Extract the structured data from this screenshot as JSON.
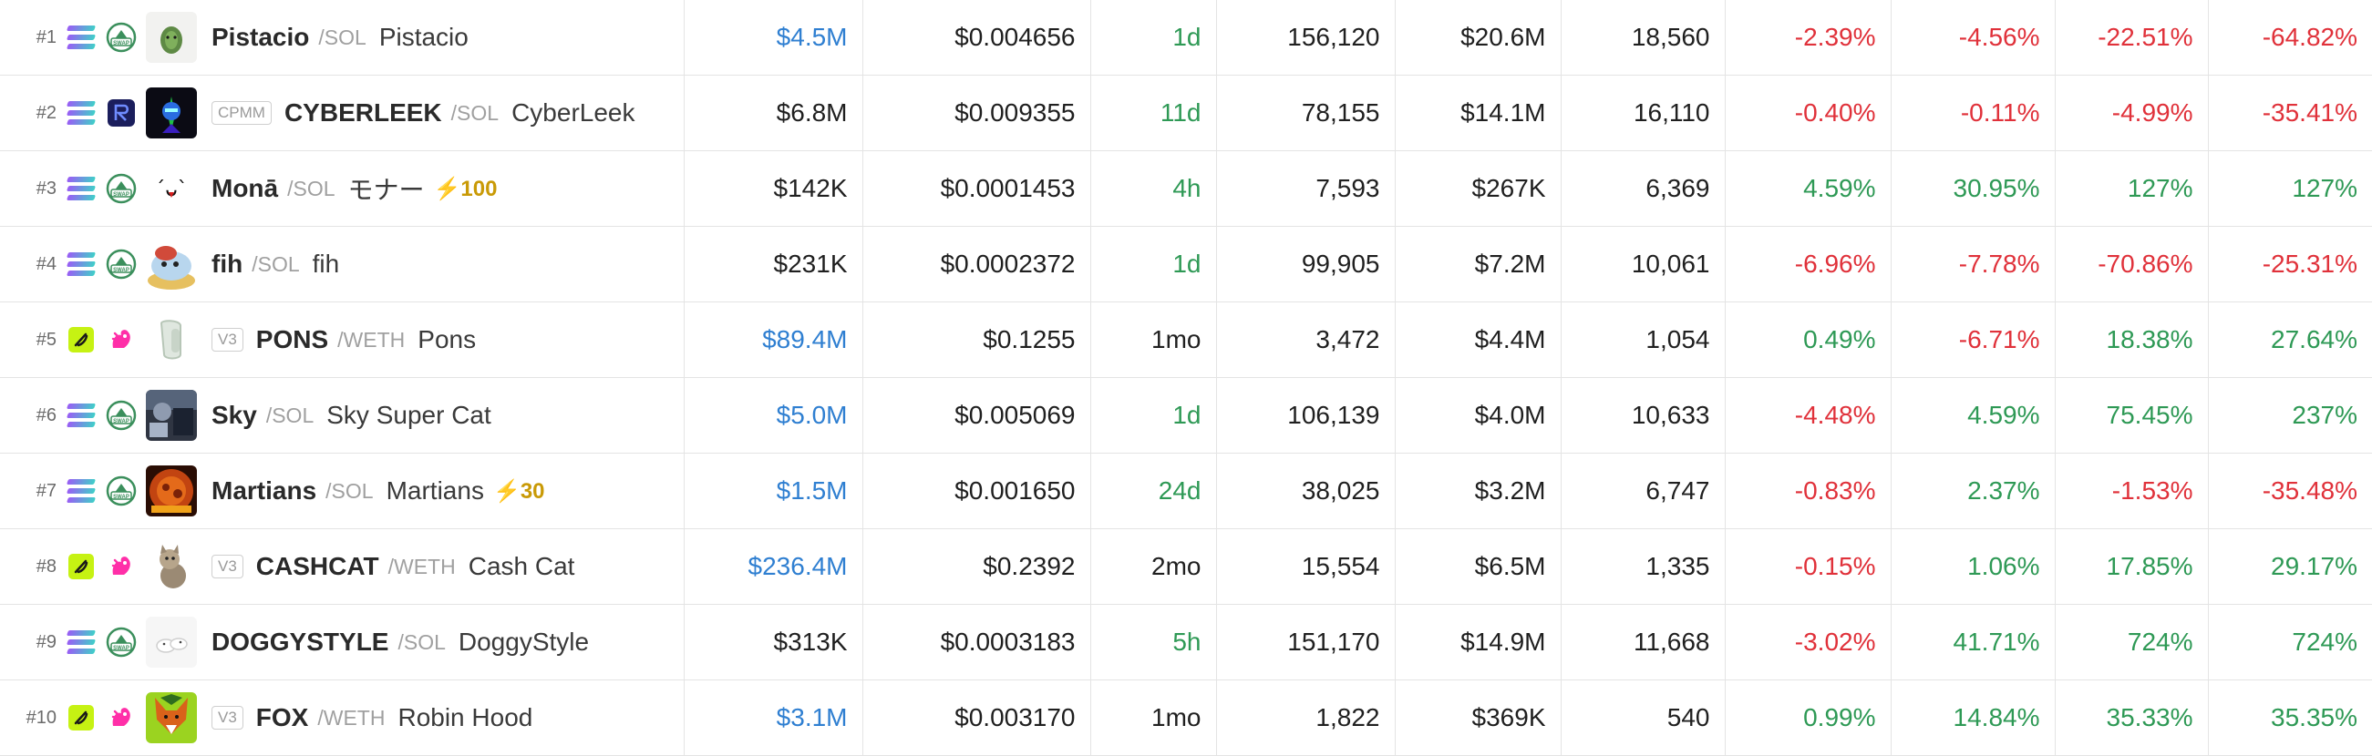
{
  "colors": {
    "positive": "#2e9955",
    "negative": "#e0313a",
    "link_blue": "#2f7fd1",
    "boost": "#c99a06"
  },
  "rows": [
    {
      "rank": "#1",
      "chain_icon": "solana-icon",
      "dex_icon": "raydium-swap-icon",
      "avatar": "pistachio-avatar",
      "badge": "",
      "symbol": "Pistacio",
      "quote": "/SOL",
      "name": "Pistacio",
      "boost": "",
      "liquidity": "$4.5M",
      "price": "$0.004656",
      "age": "1d",
      "txns": "156,120",
      "volume": "$20.6M",
      "makers": "18,560",
      "ch5m": "-2.39%",
      "ch1h": "-4.56%",
      "ch6h": "-22.51%",
      "ch24h": "-64.82%",
      "price_blue": true,
      "age_green": true
    },
    {
      "rank": "#2",
      "chain_icon": "solana-icon",
      "dex_icon": "raydium-cpmm-icon",
      "avatar": "cyberleek-avatar",
      "badge": "CPMM",
      "symbol": "CYBERLEEK",
      "quote": "/SOL",
      "name": "CyberLeek",
      "boost": "",
      "liquidity": "$6.8M",
      "price": "$0.009355",
      "age": "11d",
      "txns": "78,155",
      "volume": "$14.1M",
      "makers": "16,110",
      "ch5m": "-0.40%",
      "ch1h": "-0.11%",
      "ch6h": "-4.99%",
      "ch24h": "-35.41%",
      "age_green": true
    },
    {
      "rank": "#3",
      "chain_icon": "solana-icon",
      "dex_icon": "raydium-swap-icon",
      "avatar": "mona-avatar",
      "badge": "",
      "symbol": "Monā",
      "quote": "/SOL",
      "name": "モナー",
      "boost": "⚡100",
      "liquidity": "$142K",
      "price": "$0.0001453",
      "age": "4h",
      "txns": "7,593",
      "volume": "$267K",
      "makers": "6,369",
      "ch5m": "4.59%",
      "ch1h": "30.95%",
      "ch6h": "127%",
      "ch24h": "127%",
      "age_green": true
    },
    {
      "rank": "#4",
      "chain_icon": "solana-icon",
      "dex_icon": "raydium-swap-icon",
      "avatar": "fih-avatar",
      "badge": "",
      "symbol": "fih",
      "quote": "/SOL",
      "name": "fih",
      "boost": "",
      "liquidity": "$231K",
      "price": "$0.0002372",
      "age": "1d",
      "txns": "99,905",
      "volume": "$7.2M",
      "makers": "10,061",
      "ch5m": "-6.96%",
      "ch1h": "-7.78%",
      "ch6h": "-70.86%",
      "ch24h": "-25.31%",
      "age_green": true
    },
    {
      "rank": "#5",
      "chain_icon": "base-icon",
      "dex_icon": "uniswap-icon",
      "avatar": "pons-avatar",
      "badge": "V3",
      "symbol": "PONS",
      "quote": "/WETH",
      "name": "Pons",
      "boost": "",
      "liquidity": "$89.4M",
      "price": "$0.1255",
      "age": "1mo",
      "txns": "3,472",
      "volume": "$4.4M",
      "makers": "1,054",
      "ch5m": "0.49%",
      "ch1h": "-6.71%",
      "ch6h": "18.38%",
      "ch24h": "27.64%",
      "price_blue": true
    },
    {
      "rank": "#6",
      "chain_icon": "solana-icon",
      "dex_icon": "raydium-swap-icon",
      "avatar": "sky-avatar",
      "badge": "",
      "symbol": "Sky",
      "quote": "/SOL",
      "name": "Sky Super Cat",
      "boost": "",
      "liquidity": "$5.0M",
      "price": "$0.005069",
      "age": "1d",
      "txns": "106,139",
      "volume": "$4.0M",
      "makers": "10,633",
      "ch5m": "-4.48%",
      "ch1h": "4.59%",
      "ch6h": "75.45%",
      "ch24h": "237%",
      "price_blue": true,
      "age_green": true
    },
    {
      "rank": "#7",
      "chain_icon": "solana-icon",
      "dex_icon": "raydium-swap-icon",
      "avatar": "martians-avatar",
      "badge": "",
      "symbol": "Martians",
      "quote": "/SOL",
      "name": "Martians",
      "boost": "⚡30",
      "liquidity": "$1.5M",
      "price": "$0.001650",
      "age": "24d",
      "txns": "38,025",
      "volume": "$3.2M",
      "makers": "6,747",
      "ch5m": "-0.83%",
      "ch1h": "2.37%",
      "ch6h": "-1.53%",
      "ch24h": "-35.48%",
      "price_blue": true,
      "age_green": true
    },
    {
      "rank": "#8",
      "chain_icon": "base-icon",
      "dex_icon": "uniswap-icon",
      "avatar": "cashcat-avatar",
      "badge": "V3",
      "symbol": "CASHCAT",
      "quote": "/WETH",
      "name": "Cash Cat",
      "boost": "",
      "liquidity": "$236.4M",
      "price": "$0.2392",
      "age": "2mo",
      "txns": "15,554",
      "volume": "$6.5M",
      "makers": "1,335",
      "ch5m": "-0.15%",
      "ch1h": "1.06%",
      "ch6h": "17.85%",
      "ch24h": "29.17%",
      "price_blue": true
    },
    {
      "rank": "#9",
      "chain_icon": "solana-icon",
      "dex_icon": "raydium-swap-icon",
      "avatar": "doggystyle-avatar",
      "badge": "",
      "symbol": "DOGGYSTYLE",
      "quote": "/SOL",
      "name": "DoggyStyle",
      "boost": "",
      "liquidity": "$313K",
      "price": "$0.0003183",
      "age": "5h",
      "txns": "151,170",
      "volume": "$14.9M",
      "makers": "11,668",
      "ch5m": "-3.02%",
      "ch1h": "41.71%",
      "ch6h": "724%",
      "ch24h": "724%",
      "age_green": true
    },
    {
      "rank": "#10",
      "chain_icon": "base-icon",
      "dex_icon": "uniswap-icon",
      "avatar": "fox-avatar",
      "badge": "V3",
      "symbol": "FOX",
      "quote": "/WETH",
      "name": "Robin Hood",
      "boost": "",
      "liquidity": "$3.1M",
      "price": "$0.003170",
      "age": "1mo",
      "txns": "1,822",
      "volume": "$369K",
      "makers": "540",
      "ch5m": "0.99%",
      "ch1h": "14.84%",
      "ch6h": "35.33%",
      "ch24h": "35.35%",
      "price_blue": true
    }
  ]
}
